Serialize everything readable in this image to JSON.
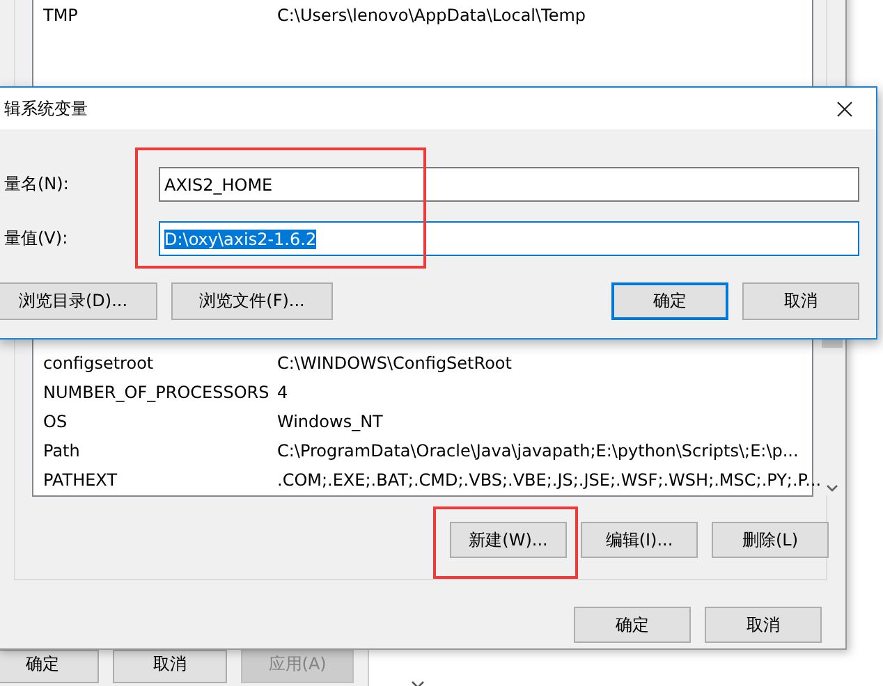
{
  "env_window": {
    "user_variables": [
      {
        "name": "TMP",
        "value": "C:\\Users\\lenovo\\AppData\\Local\\Temp"
      }
    ],
    "system_variables": [
      {
        "name": "configsetroot",
        "value": "C:\\WINDOWS\\ConfigSetRoot"
      },
      {
        "name": "NUMBER_OF_PROCESSORS",
        "value": "4"
      },
      {
        "name": "OS",
        "value": "Windows_NT"
      },
      {
        "name": "Path",
        "value": "C:\\ProgramData\\Oracle\\Java\\javapath;E:\\python\\Scripts\\;E:\\p..."
      },
      {
        "name": "PATHEXT",
        "value": ".COM;.EXE;.BAT;.CMD;.VBS;.VBE;.JS;.JSE;.WSF;.WSH;.MSC;.PY;.P..."
      }
    ],
    "list_buttons": [
      {
        "label": "新建(W)...",
        "highlighted": true
      },
      {
        "label": "编辑(I)...",
        "highlighted": false
      },
      {
        "label": "删除(L)",
        "highlighted": false
      }
    ],
    "dialog_buttons": [
      {
        "label": "确定"
      },
      {
        "label": "取消"
      }
    ]
  },
  "edit_dialog": {
    "title": "辑系统变量",
    "name_label": "量名(N):",
    "name_value": "AXIS2_HOME",
    "value_label": "量值(V):",
    "value_value": "D:\\oxy\\axis2-1.6.2",
    "value_selected": true,
    "fields_highlighted": true,
    "buttons": [
      {
        "label": "浏览目录(D)...",
        "default": false
      },
      {
        "label": "浏览文件(F)...",
        "default": false
      },
      {
        "label": "确定",
        "default": true
      },
      {
        "label": "取消",
        "default": false
      }
    ]
  },
  "back_window_buttons": [
    {
      "label": "确定",
      "disabled": false
    },
    {
      "label": "取消",
      "disabled": false
    },
    {
      "label": "应用(A)",
      "disabled": true
    }
  ]
}
